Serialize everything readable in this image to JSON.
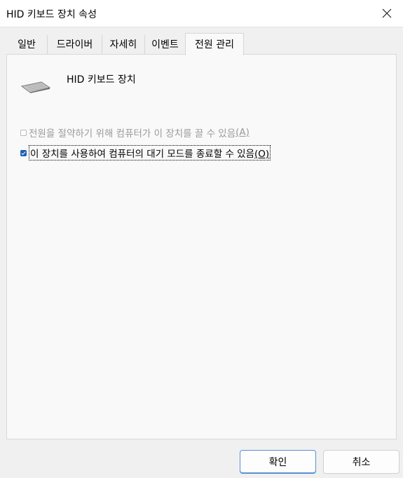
{
  "window": {
    "title": "HID 키보드 장치 속성"
  },
  "tabs": [
    {
      "label": "일반"
    },
    {
      "label": "드라이버"
    },
    {
      "label": "자세히"
    },
    {
      "label": "이벤트"
    },
    {
      "label": "전원 관리",
      "selected": true
    }
  ],
  "device": {
    "name": "HID 키보드 장치",
    "icon": "keyboard-icon"
  },
  "options": [
    {
      "label": "전원을 절약하기 위해 컴퓨터가 이 장치를 끌 수 있음",
      "accel": "(A)",
      "checked": false,
      "enabled": false
    },
    {
      "label": "이 장치를 사용하여 컴퓨터의 대기 모드를 종료할 수 있음",
      "accel": "(O)",
      "checked": true,
      "enabled": true
    }
  ],
  "buttons": {
    "ok": "확인",
    "cancel": "취소"
  },
  "colors": {
    "accent": "#1f5fb8",
    "window_bg": "#f0f0f0",
    "panel_bg": "#f9f9f9"
  }
}
